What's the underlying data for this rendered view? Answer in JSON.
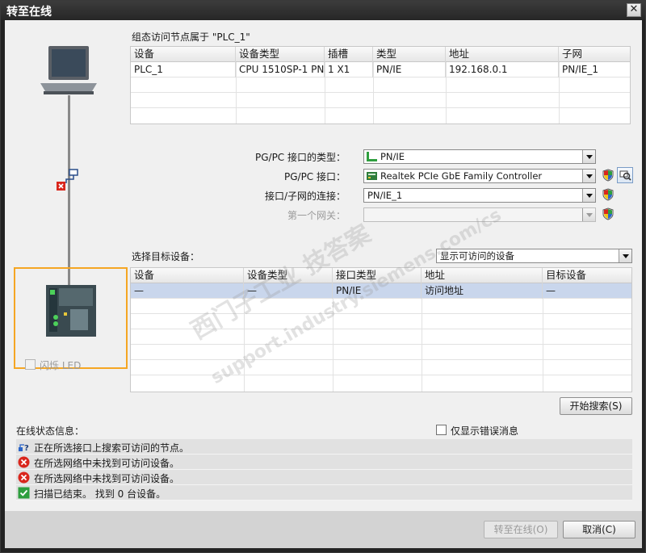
{
  "window": {
    "title": "转至在线",
    "close_glyph": "✕"
  },
  "config_header": "组态访问节点属于 \"PLC_1\"",
  "config_table": {
    "columns": [
      "设备",
      "设备类型",
      "插槽",
      "类型",
      "地址",
      "子网"
    ],
    "rows": [
      [
        "PLC_1",
        "CPU 1510SP-1 PN",
        "1 X1",
        "PN/IE",
        "192.168.0.1",
        "PN/IE_1"
      ]
    ]
  },
  "interface": {
    "type_label": "PG/PC 接口的类型：",
    "type_value": "PN/IE",
    "pgpc_label": "PG/PC 接口：",
    "pgpc_value": "Realtek PCIe GbE Family Controller",
    "conn_label": "接口/子网的连接：",
    "conn_value": "PN/IE_1",
    "gateway_label": "第一个网关：",
    "gateway_value": ""
  },
  "target": {
    "label": "选择目标设备：",
    "filter_value": "显示可访问的设备",
    "columns": [
      "设备",
      "设备类型",
      "接口类型",
      "地址",
      "目标设备"
    ],
    "rows": [
      [
        "—",
        "—",
        "PN/IE",
        "访问地址",
        "—"
      ]
    ]
  },
  "flash_led_label": "闪烁 LED",
  "start_search_button": "开始搜索(S)",
  "status": {
    "title": "在线状态信息：",
    "only_errors_label": "仅显示错误消息",
    "messages": [
      {
        "icon": "search-progress-icon",
        "text": "正在所选接口上搜索可访问的节点。"
      },
      {
        "icon": "error-icon",
        "text": "在所选网络中未找到可访问设备。"
      },
      {
        "icon": "error-icon",
        "text": "在所选网络中未找到可访问设备。"
      },
      {
        "icon": "success-check-icon",
        "text": "扫描已结束。 找到 0 台设备。"
      }
    ]
  },
  "footer": {
    "go_online_button": "转至在线(O)",
    "cancel_button": "取消(C)"
  },
  "watermark": {
    "line1": "西门子工业 技答案",
    "line2": "support.industry.siemens.com/cs"
  },
  "colors": {
    "highlight_orange": "#f5a623",
    "selection_blue": "#c9d6ec",
    "error_red": "#d9261c",
    "ok_green": "#2e9e3e"
  }
}
